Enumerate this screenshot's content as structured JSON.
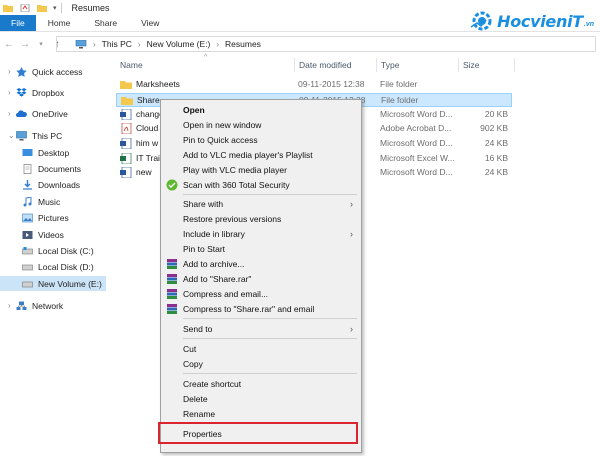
{
  "window": {
    "title": "Resumes"
  },
  "ribbon": {
    "tabs": [
      "File",
      "Home",
      "Share",
      "View"
    ]
  },
  "logo": {
    "brand": "HocvieniT",
    "suffix": ".vn"
  },
  "address": {
    "crumbs": [
      "This PC",
      "New Volume (E:)",
      "Resumes"
    ]
  },
  "nav": {
    "items": [
      {
        "label": "Quick access"
      },
      {
        "label": "Dropbox"
      },
      {
        "label": "OneDrive"
      },
      {
        "label": "This PC"
      },
      {
        "label": "Desktop"
      },
      {
        "label": "Documents"
      },
      {
        "label": "Downloads"
      },
      {
        "label": "Music"
      },
      {
        "label": "Pictures"
      },
      {
        "label": "Videos"
      },
      {
        "label": "Local Disk (C:)"
      },
      {
        "label": "Local Disk (D:)"
      },
      {
        "label": "New Volume (E:)"
      },
      {
        "label": "Network"
      }
    ]
  },
  "columns": {
    "name": "Name",
    "date": "Date modified",
    "type": "Type",
    "size": "Size"
  },
  "files": [
    {
      "name": "Marksheets",
      "date": "09-11-2015 12:38",
      "type": "File folder",
      "size": ""
    },
    {
      "name": "Share",
      "date": "09-11-2015 12:38",
      "type": "File folder",
      "size": ""
    },
    {
      "name": "change",
      "date": "",
      "type": "Microsoft Word D...",
      "size": "20 KB"
    },
    {
      "name": "Cloud",
      "date": "",
      "type": "Adobe Acrobat D...",
      "size": "902 KB"
    },
    {
      "name": "him w",
      "date": "",
      "type": "Microsoft Word D...",
      "size": "24 KB"
    },
    {
      "name": "IT Trai",
      "date": "",
      "type": "Microsoft Excel W...",
      "size": "16 KB"
    },
    {
      "name": "new",
      "date": "",
      "type": "Microsoft Word D...",
      "size": "24 KB"
    }
  ],
  "menu": {
    "items": [
      {
        "label": "Open"
      },
      {
        "label": "Open in new window"
      },
      {
        "label": "Pin to Quick access"
      },
      {
        "label": "Add to VLC media player's Playlist"
      },
      {
        "label": "Play with VLC media player"
      },
      {
        "label": "Scan with 360 Total Security"
      },
      {
        "label": "Share with"
      },
      {
        "label": "Restore previous versions"
      },
      {
        "label": "Include in library"
      },
      {
        "label": "Pin to Start"
      },
      {
        "label": "Add to archive..."
      },
      {
        "label": "Add to \"Share.rar\""
      },
      {
        "label": "Compress and email..."
      },
      {
        "label": "Compress to \"Share.rar\" and email"
      },
      {
        "label": "Send to"
      },
      {
        "label": "Cut"
      },
      {
        "label": "Copy"
      },
      {
        "label": "Create shortcut"
      },
      {
        "label": "Delete"
      },
      {
        "label": "Rename"
      },
      {
        "label": "Properties"
      }
    ]
  },
  "colors": {
    "accent": "#1979ca",
    "selection": "#cce8ff",
    "highlight": "#d9262e",
    "folder": "#f2c94c"
  }
}
